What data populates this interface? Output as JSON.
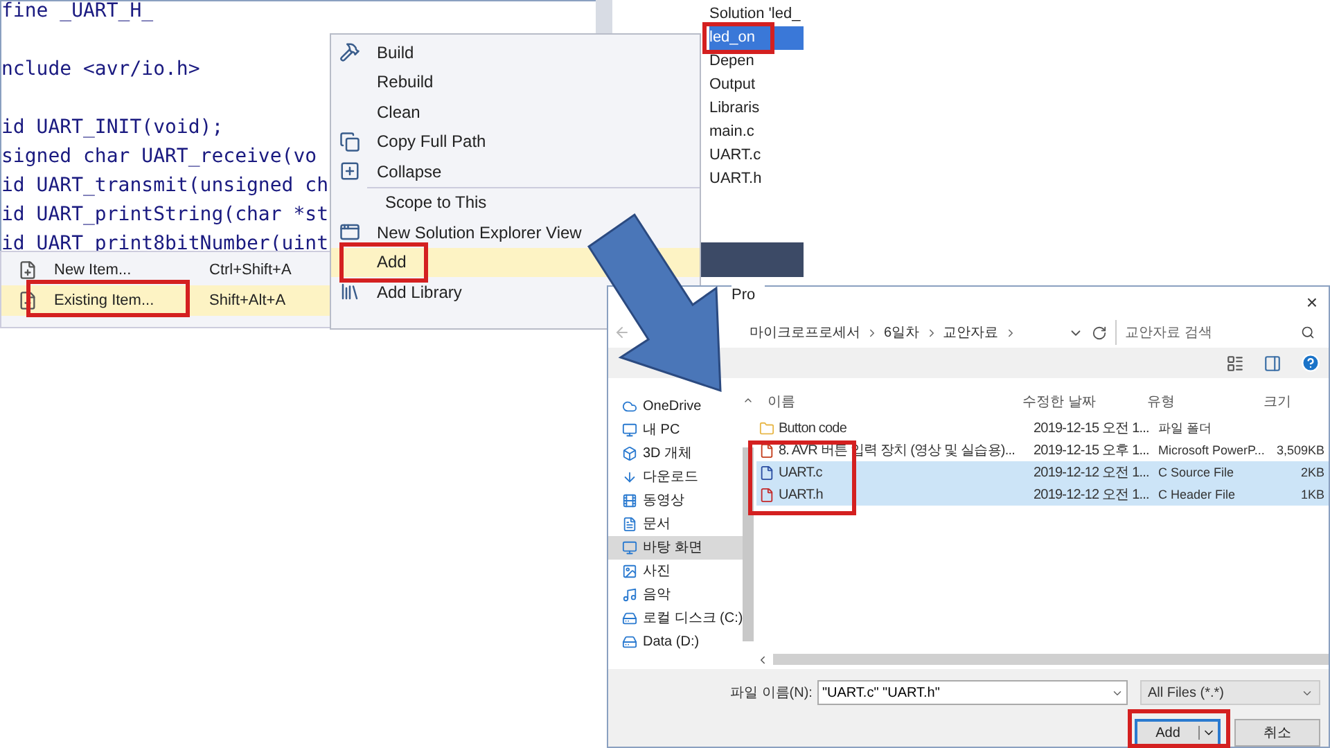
{
  "code_editor": {
    "lines": [
      "fine _UART_H_",
      "nclude <avr/io.h>",
      "id UART_INIT(void);",
      "signed char UART_receive(vo",
      "id UART_transmit(unsigned ch",
      "id UART_printString(char *st",
      "id UART_print8bitNumber(uint"
    ]
  },
  "solution_explorer": {
    "items": [
      {
        "label": "Solution 'led_",
        "selected": false
      },
      {
        "label": "led_on",
        "selected": true
      },
      {
        "label": "Depen",
        "selected": false
      },
      {
        "label": "Output",
        "selected": false
      },
      {
        "label": "Libraris",
        "selected": false
      },
      {
        "label": "main.c",
        "selected": false
      },
      {
        "label": "UART.c",
        "selected": false
      },
      {
        "label": "UART.h",
        "selected": false
      }
    ],
    "tab": "Pro"
  },
  "context_menu": {
    "items": [
      {
        "label": "Build",
        "selected": false
      },
      {
        "label": "Rebuild",
        "selected": false
      },
      {
        "label": "Clean",
        "selected": false
      },
      {
        "label": "Copy Full Path",
        "selected": false
      },
      {
        "label": "Collapse",
        "selected": false
      },
      {
        "label": "Scope to This",
        "selected": false
      },
      {
        "label": "New Solution Explorer View",
        "selected": false
      },
      {
        "label": "Add",
        "selected": true
      },
      {
        "label": "Add Library",
        "selected": false
      }
    ]
  },
  "add_submenu": {
    "items": [
      {
        "label": "New Item...",
        "shortcut": "Ctrl+Shift+A",
        "selected": false
      },
      {
        "label": "Existing Item...",
        "shortcut": "Shift+Alt+A",
        "selected": true
      }
    ]
  },
  "file_dialog": {
    "close": "×",
    "breadcrumb": [
      "마이크로프로세서",
      "6일차",
      "교안자료"
    ],
    "search": {
      "placeholder": "교안자료 검색"
    },
    "nav": [
      {
        "label": "OneDrive",
        "selected": false
      },
      {
        "label": "내 PC",
        "selected": false
      },
      {
        "label": "3D 개체",
        "selected": false
      },
      {
        "label": "다운로드",
        "selected": false
      },
      {
        "label": "동영상",
        "selected": false
      },
      {
        "label": "문서",
        "selected": false
      },
      {
        "label": "바탕 화면",
        "selected": true
      },
      {
        "label": "사진",
        "selected": false
      },
      {
        "label": "음악",
        "selected": false
      },
      {
        "label": "로컬 디스크 (C:)",
        "selected": false
      },
      {
        "label": "Data (D:)",
        "selected": false
      }
    ],
    "columns": [
      "이름",
      "수정한 날짜",
      "유형",
      "크기"
    ],
    "files": [
      {
        "name": "Button code",
        "modified": "2019-12-15 오전 1...",
        "type": "파일 폴더",
        "kind": "folder",
        "selected": false
      },
      {
        "name": "8. AVR 버튼 입력 장치 (영상 및 실습용)...",
        "modified": "2019-12-15 오후 1...",
        "type": "Microsoft PowerP...",
        "size": "3,509KB",
        "kind": "ppt",
        "selected": false
      },
      {
        "name": "UART.c",
        "modified": "2019-12-12 오전 1...",
        "type": "C Source File",
        "size": "2KB",
        "kind": "c",
        "selected": true
      },
      {
        "name": "UART.h",
        "modified": "2019-12-12 오전 1...",
        "type": "C Header File",
        "size": "1KB",
        "kind": "h",
        "selected": true
      }
    ],
    "filename_label": "파일 이름(N):",
    "filename": "\"UART.c\" \"UART.h\"",
    "filter": "All Files (*.*)",
    "add_button": "Add",
    "cancel_button": "취소"
  }
}
